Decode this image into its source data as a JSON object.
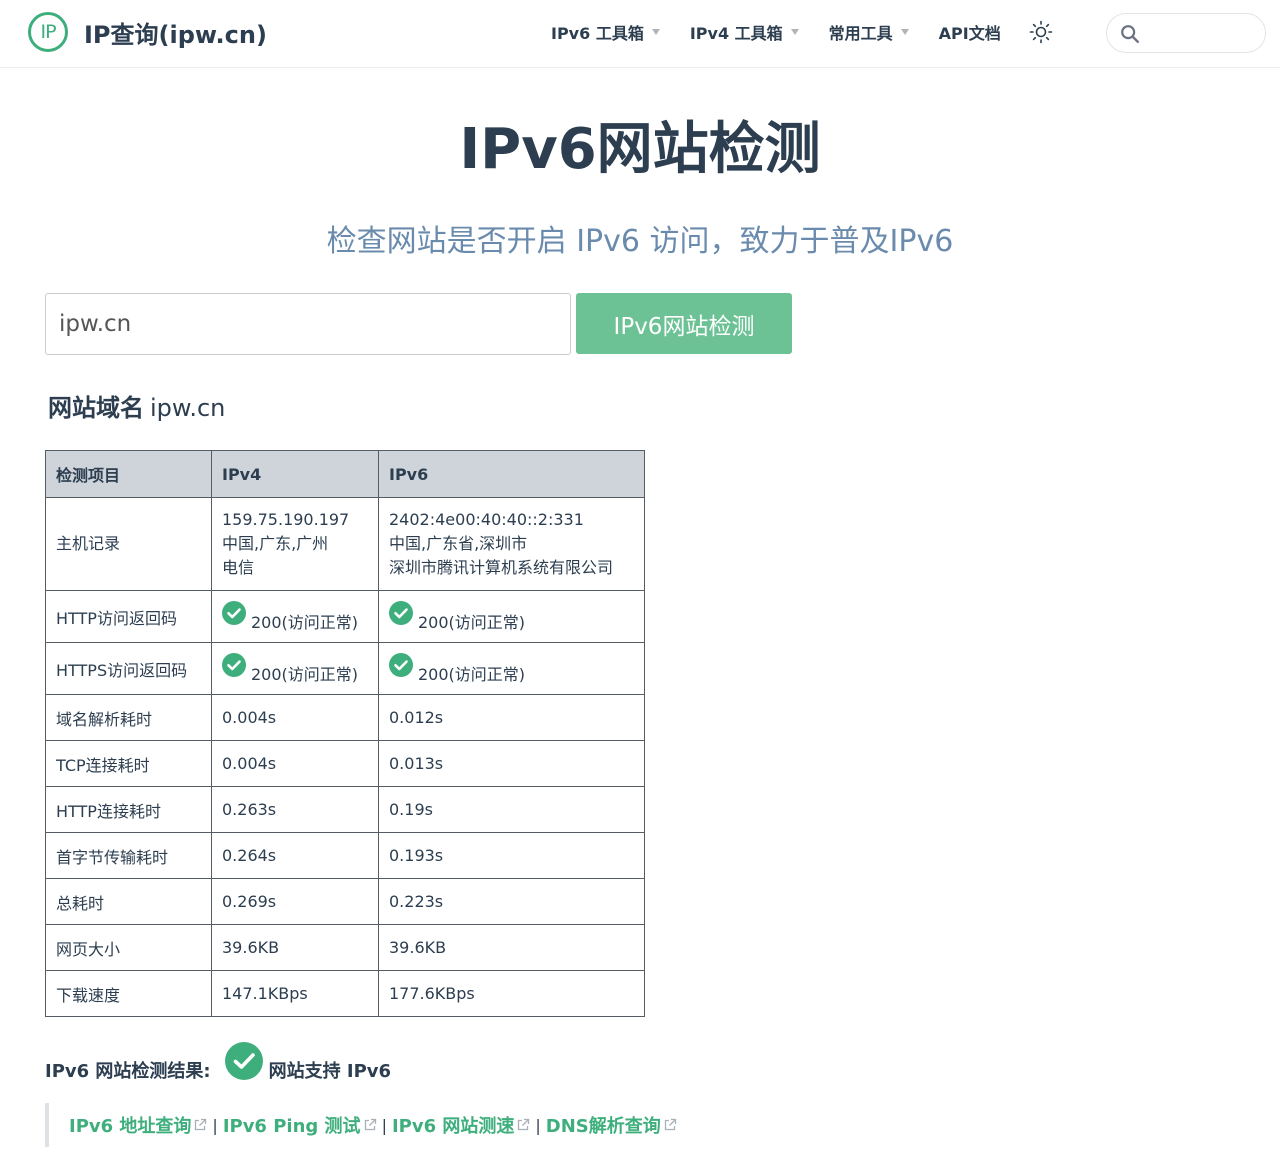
{
  "header": {
    "logo_text": "IP",
    "site_name": "IP查询(ipw.cn)",
    "nav": [
      {
        "label": "IPv6 工具箱"
      },
      {
        "label": "IPv4 工具箱"
      },
      {
        "label": "常用工具"
      },
      {
        "label": "API文档"
      }
    ],
    "search": {
      "placeholder": "",
      "value": ""
    }
  },
  "hero": {
    "title": "IPv6网站检测",
    "subtitle": "检查网站是否开启 IPv6 访问，致力于普及IPv6"
  },
  "form": {
    "domain_value": "ipw.cn",
    "button_label": "IPv6网站检测"
  },
  "domain_section": {
    "label": "网站域名",
    "value": "ipw.cn"
  },
  "table": {
    "headers": [
      "检测项目",
      "IPv4",
      "IPv6"
    ],
    "host_row": {
      "label": "主机记录",
      "ipv4": [
        "159.75.190.197",
        "中国,广东,广州",
        "电信"
      ],
      "ipv6": [
        "2402:4e00:40:40::2:331",
        "中国,广东省,深圳市",
        "深圳市腾讯计算机系统有限公司"
      ]
    },
    "status_rows": [
      {
        "label": "HTTP访问返回码",
        "ipv4": "200(访问正常)",
        "ipv6": "200(访问正常)"
      },
      {
        "label": "HTTPS访问返回码",
        "ipv4": "200(访问正常)",
        "ipv6": "200(访问正常)"
      }
    ],
    "rows": [
      {
        "label": "域名解析耗时",
        "ipv4": "0.004s",
        "ipv6": "0.012s"
      },
      {
        "label": "TCP连接耗时",
        "ipv4": "0.004s",
        "ipv6": "0.013s"
      },
      {
        "label": "HTTP连接耗时",
        "ipv4": "0.263s",
        "ipv6": "0.19s"
      },
      {
        "label": "首字节传输耗时",
        "ipv4": "0.264s",
        "ipv6": "0.193s"
      },
      {
        "label": "总耗时",
        "ipv4": "0.269s",
        "ipv6": "0.223s"
      },
      {
        "label": "网页大小",
        "ipv4": "39.6KB",
        "ipv6": "39.6KB"
      },
      {
        "label": "下载速度",
        "ipv4": "147.1KBps",
        "ipv6": "177.6KBps"
      }
    ]
  },
  "result": {
    "label": "IPv6 网站检测结果:",
    "value": "网站支持 IPv6"
  },
  "links": [
    {
      "label": "IPv6 地址查询"
    },
    {
      "label": "IPv6 Ping 测试"
    },
    {
      "label": "IPv6 网站测速"
    },
    {
      "label": "DNS解析查询"
    }
  ],
  "link_separator": "|",
  "colors": {
    "accent": "#3eaf7c",
    "button": "#6cc295",
    "subtitle": "#6a8bad",
    "text": "#2c3e50",
    "table_header_bg": "#cfd3da"
  },
  "icons": {
    "theme": "sun-icon",
    "search": "search-icon",
    "status": "check-circle-icon",
    "link": "external-link-icon"
  }
}
